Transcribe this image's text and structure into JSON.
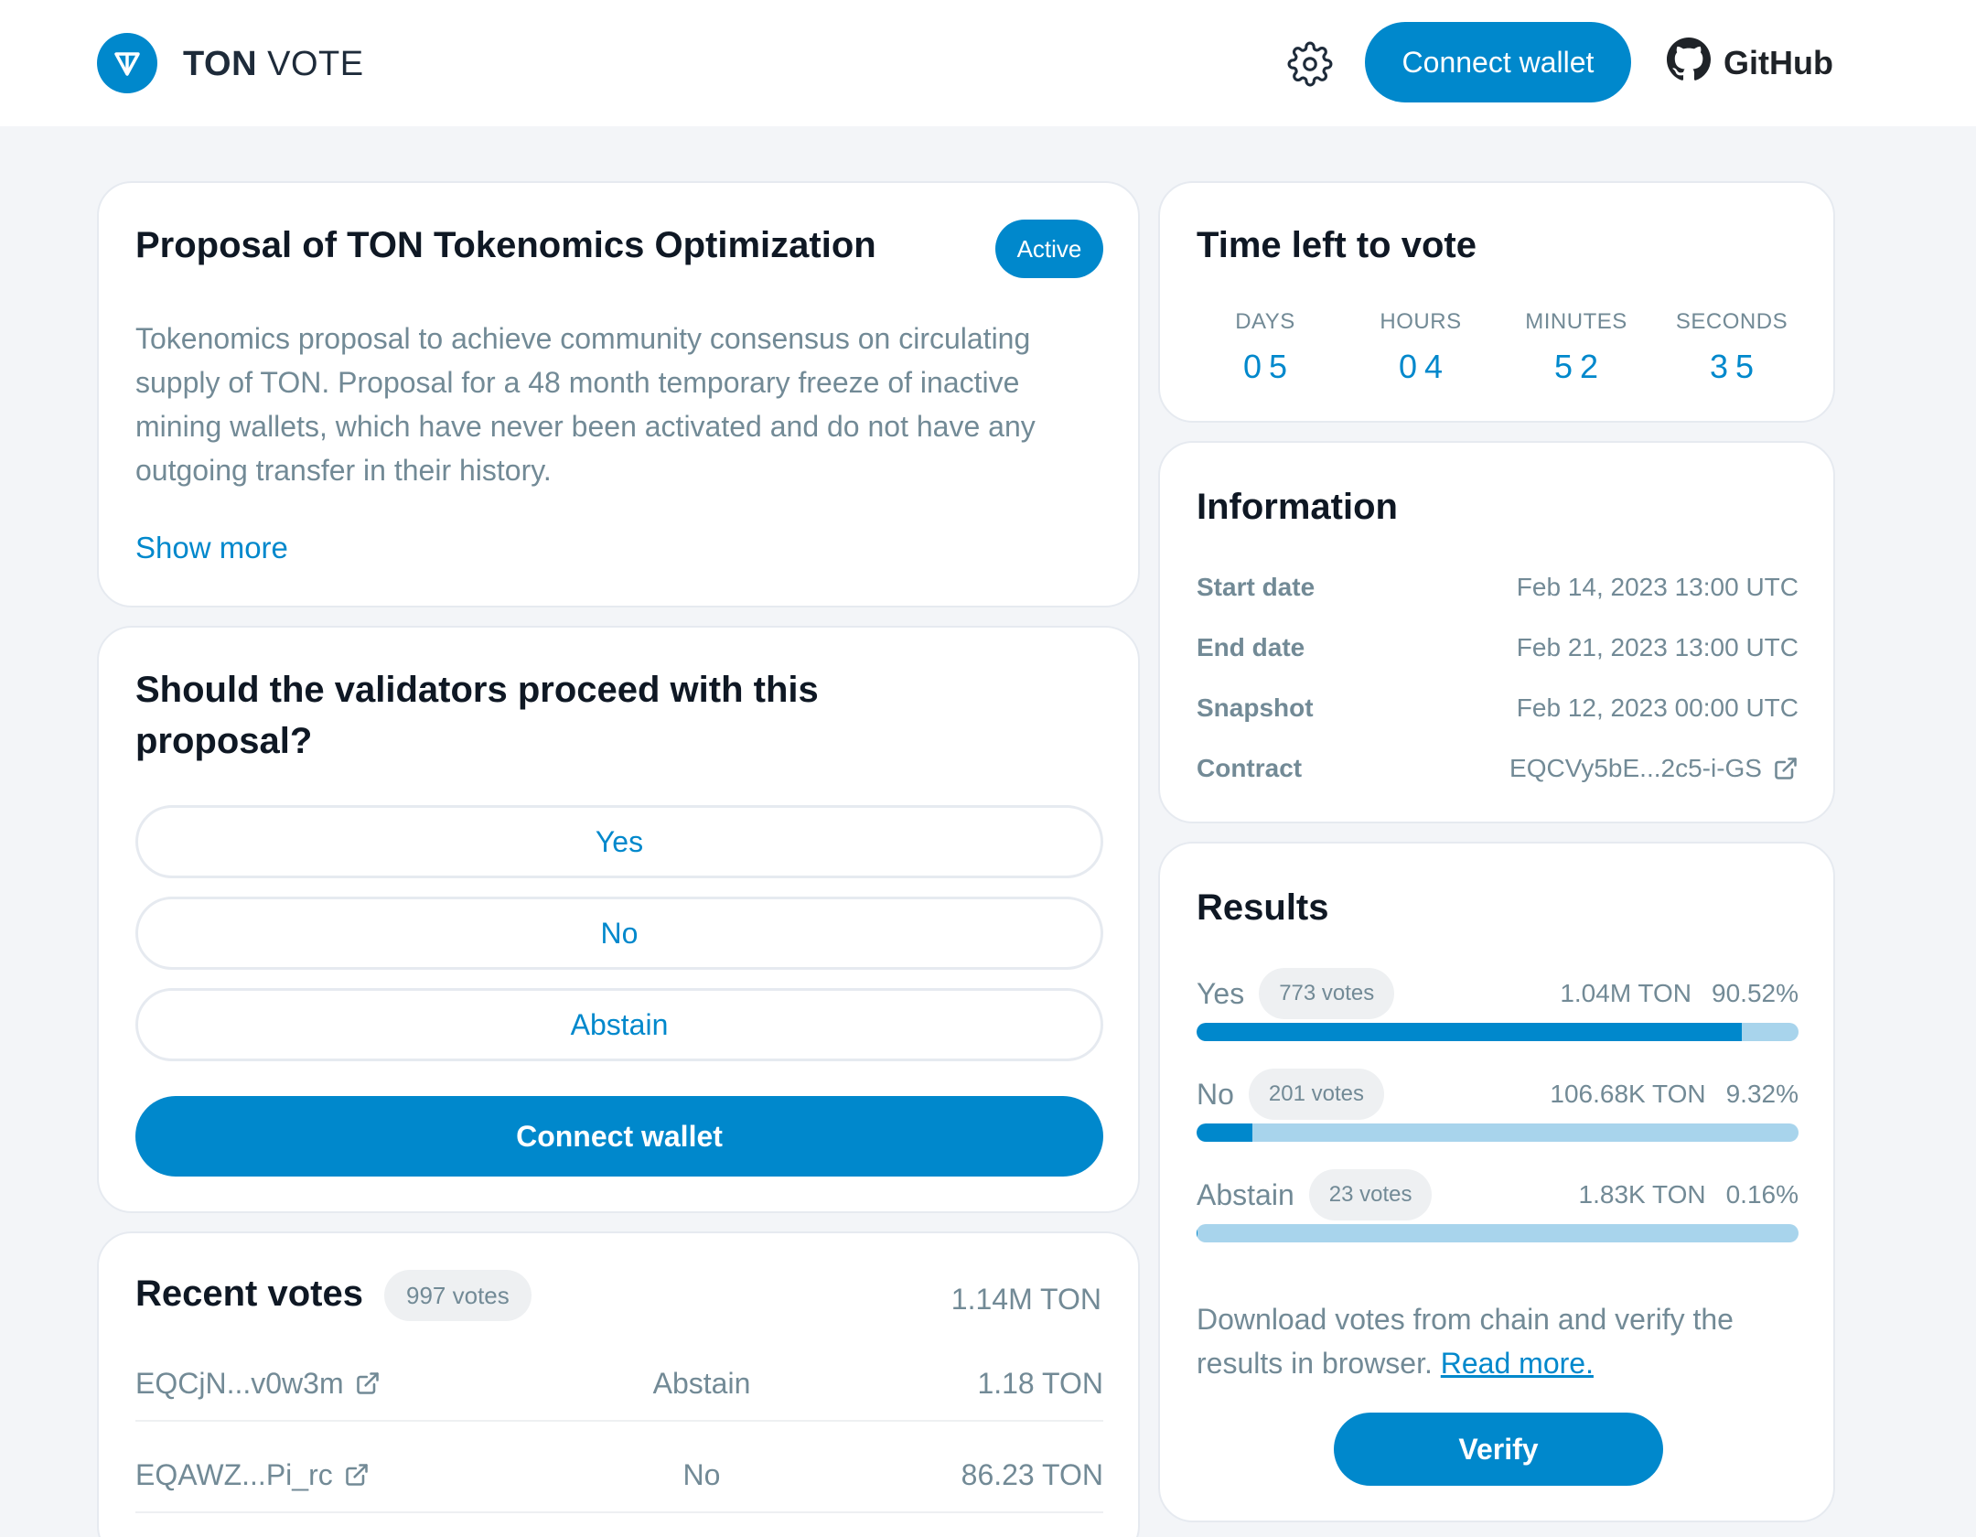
{
  "header": {
    "brand_bold": "TON",
    "brand_light": "VOTE",
    "connect_label": "Connect wallet",
    "github_label": "GitHub",
    "icons": {
      "logo": "ton-logo-icon",
      "settings": "gear-icon",
      "github": "github-icon"
    }
  },
  "proposal": {
    "title": "Proposal of TON Tokenomics Optimization",
    "status": "Active",
    "description": "Tokenomics proposal to achieve community consensus on circulating supply of TON. Proposal for a 48 month temporary freeze of inactive mining wallets, which have never been activated and do not have any outgoing transfer in their history.",
    "show_more": "Show more"
  },
  "question": {
    "title": "Should the validators proceed with this proposal?",
    "options": [
      "Yes",
      "No",
      "Abstain"
    ],
    "connect_label": "Connect wallet"
  },
  "recent_votes": {
    "title": "Recent votes",
    "count_label": "997 votes",
    "total": "1.14M TON",
    "rows": [
      {
        "address": "EQCjN...v0w3m",
        "choice": "Abstain",
        "amount": "1.18 TON"
      },
      {
        "address": "EQAWZ...Pi_rc",
        "choice": "No",
        "amount": "86.23 TON"
      }
    ]
  },
  "time_left": {
    "title": "Time left to vote",
    "units": [
      {
        "label": "DAYS",
        "value": "05"
      },
      {
        "label": "HOURS",
        "value": "04"
      },
      {
        "label": "MINUTES",
        "value": "52"
      },
      {
        "label": "SECONDS",
        "value": "35"
      }
    ]
  },
  "information": {
    "title": "Information",
    "rows": [
      {
        "key": "Start date",
        "value": "Feb 14, 2023 13:00 UTC"
      },
      {
        "key": "End date",
        "value": "Feb 21, 2023 13:00 UTC"
      },
      {
        "key": "Snapshot",
        "value": "Feb 12, 2023 00:00 UTC"
      },
      {
        "key": "Contract",
        "value": "EQCVy5bE...2c5-i-GS"
      }
    ]
  },
  "results": {
    "title": "Results",
    "rows": [
      {
        "name": "Yes",
        "votes": "773 votes",
        "ton": "1.04M TON",
        "percent": "90.52%",
        "fraction": 0.9052
      },
      {
        "name": "No",
        "votes": "201 votes",
        "ton": "106.68K TON",
        "percent": "9.32%",
        "fraction": 0.0932
      },
      {
        "name": "Abstain",
        "votes": "23 votes",
        "ton": "1.83K TON",
        "percent": "0.16%",
        "fraction": 0.0016
      }
    ],
    "verify_text": "Download votes from chain and verify the results in browser.",
    "read_more": "Read more.",
    "verify_label": "Verify"
  },
  "colors": {
    "accent": "#0088CC",
    "bar_track": "#A8D4EC",
    "muted": "#728A96",
    "background": "#F3F5F8"
  }
}
